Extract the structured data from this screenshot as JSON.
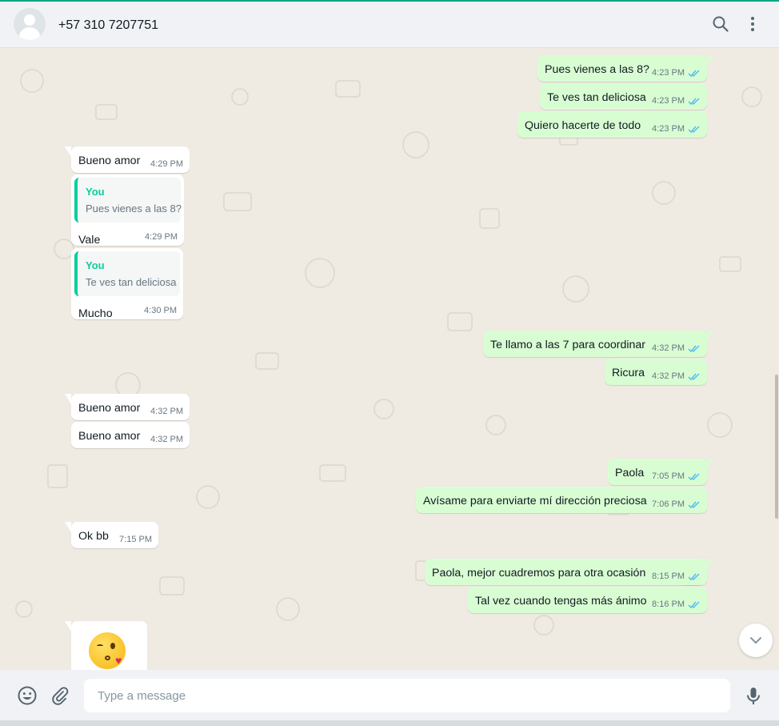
{
  "header": {
    "contact_name": "+57 310 7207751",
    "icons": [
      "avatar-icon",
      "search-icon",
      "menu-icon"
    ]
  },
  "messages": {
    "m1": {
      "text": "Pues vienes a las 8?",
      "time": "4:23 PM",
      "dir": "out"
    },
    "m2": {
      "text": "Te ves tan deliciosa",
      "time": "4:23 PM",
      "dir": "out"
    },
    "m3": {
      "text": "Quiero hacerte de todo",
      "time": "4:23 PM",
      "dir": "out"
    },
    "m4": {
      "text": "Bueno amor",
      "time": "4:29 PM",
      "dir": "in"
    },
    "m5": {
      "quote_author": "You",
      "quote_text": "Pues vienes a las 8?",
      "text": "Vale",
      "time": "4:29 PM",
      "dir": "in"
    },
    "m6": {
      "quote_author": "You",
      "quote_text": "Te ves tan deliciosa",
      "text": "Mucho",
      "time": "4:30 PM",
      "dir": "in"
    },
    "m7": {
      "text": "Te llamo a las 7 para coordinar",
      "time": "4:32 PM",
      "dir": "out"
    },
    "m8": {
      "text": "Ricura",
      "time": "4:32 PM",
      "dir": "out"
    },
    "m9": {
      "text": "Bueno amor",
      "time": "4:32 PM",
      "dir": "in"
    },
    "m10": {
      "text": "Bueno amor",
      "time": "4:32 PM",
      "dir": "in"
    },
    "m11": {
      "text": "Paola",
      "time": "7:05 PM",
      "dir": "out"
    },
    "m12": {
      "text": "Avísame para enviarte mí dirección preciosa",
      "time": "7:06 PM",
      "dir": "out"
    },
    "m13": {
      "text": "Ok bb",
      "time": "7:15 PM",
      "dir": "in"
    },
    "m14": {
      "text": "Paola, mejor cuadremos para otra ocasión",
      "time": "8:15 PM",
      "dir": "out"
    },
    "m15": {
      "text": "Tal vez cuando tengas más ánimo",
      "time": "8:16 PM",
      "dir": "out"
    },
    "m16": {
      "emoji": "face-blowing-a-kiss",
      "dir": "in"
    }
  },
  "composer": {
    "placeholder": "Type a message",
    "icons": [
      "emoji-icon",
      "attach-icon",
      "microphone-icon"
    ]
  },
  "colors": {
    "accent": "#00a884",
    "outgoing_bubble": "#d9fdd3",
    "incoming_bubble": "#ffffff",
    "read_ticks": "#53bdeb",
    "chat_background": "#efeae2"
  }
}
